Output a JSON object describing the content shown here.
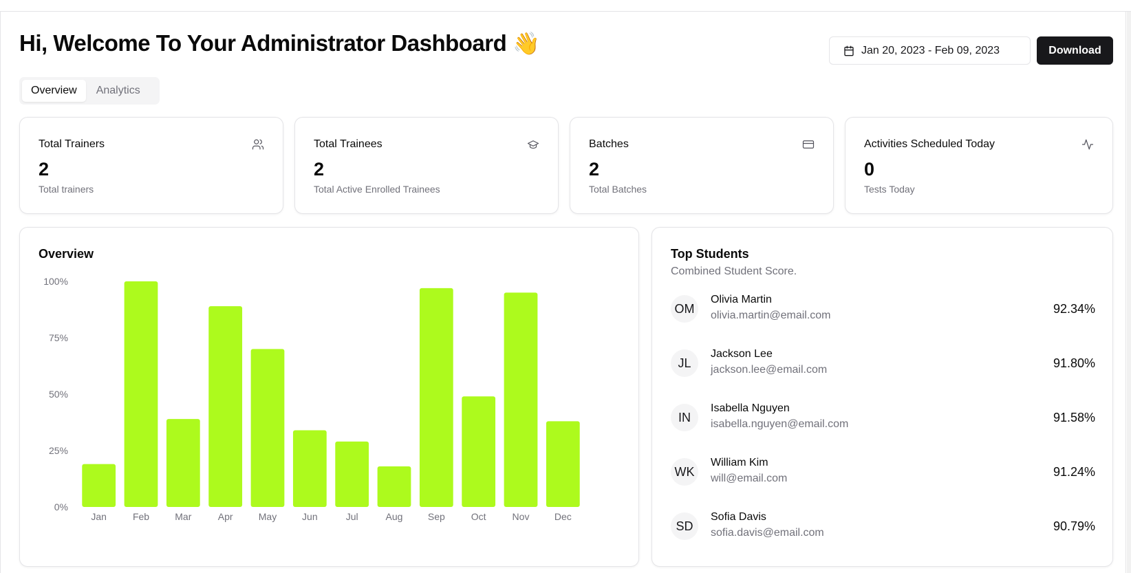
{
  "header": {
    "title": "Hi, Welcome To Your Administrator Dashboard",
    "title_emoji": "👋",
    "date_range": "Jan 20, 2023 - Feb 09, 2023",
    "download_label": "Download"
  },
  "tabs": [
    {
      "label": "Overview",
      "active": true
    },
    {
      "label": "Analytics",
      "active": false
    }
  ],
  "stats": [
    {
      "title": "Total Trainers",
      "value": "2",
      "sub": "Total trainers",
      "icon": "users-icon"
    },
    {
      "title": "Total Trainees",
      "value": "2",
      "sub": "Total Active Enrolled Trainees",
      "icon": "graduation-cap-icon"
    },
    {
      "title": "Batches",
      "value": "2",
      "sub": "Total Batches",
      "icon": "credit-card-icon"
    },
    {
      "title": "Activities Scheduled Today",
      "value": "0",
      "sub": "Tests Today",
      "icon": "activity-icon"
    }
  ],
  "overview": {
    "title": "Overview"
  },
  "chart_data": {
    "type": "bar",
    "categories": [
      "Jan",
      "Feb",
      "Mar",
      "Apr",
      "May",
      "Jun",
      "Jul",
      "Aug",
      "Sep",
      "Oct",
      "Nov",
      "Dec"
    ],
    "values": [
      19,
      100,
      39,
      89,
      70,
      34,
      29,
      18,
      97,
      49,
      95,
      38
    ],
    "ylim": [
      0,
      100
    ],
    "yticks": [
      "0%",
      "25%",
      "50%",
      "75%",
      "100%"
    ],
    "bar_color": "#adfa1d",
    "grid": false
  },
  "top_students": {
    "title": "Top Students",
    "subtitle": "Combined Student Score.",
    "items": [
      {
        "initials": "OM",
        "name": "Olivia Martin",
        "email": "olivia.martin@email.com",
        "score": "92.34%"
      },
      {
        "initials": "JL",
        "name": "Jackson Lee",
        "email": "jackson.lee@email.com",
        "score": "91.80%"
      },
      {
        "initials": "IN",
        "name": "Isabella Nguyen",
        "email": "isabella.nguyen@email.com",
        "score": "91.58%"
      },
      {
        "initials": "WK",
        "name": "William Kim",
        "email": "will@email.com",
        "score": "91.24%"
      },
      {
        "initials": "SD",
        "name": "Sofia Davis",
        "email": "sofia.davis@email.com",
        "score": "90.79%"
      }
    ]
  }
}
